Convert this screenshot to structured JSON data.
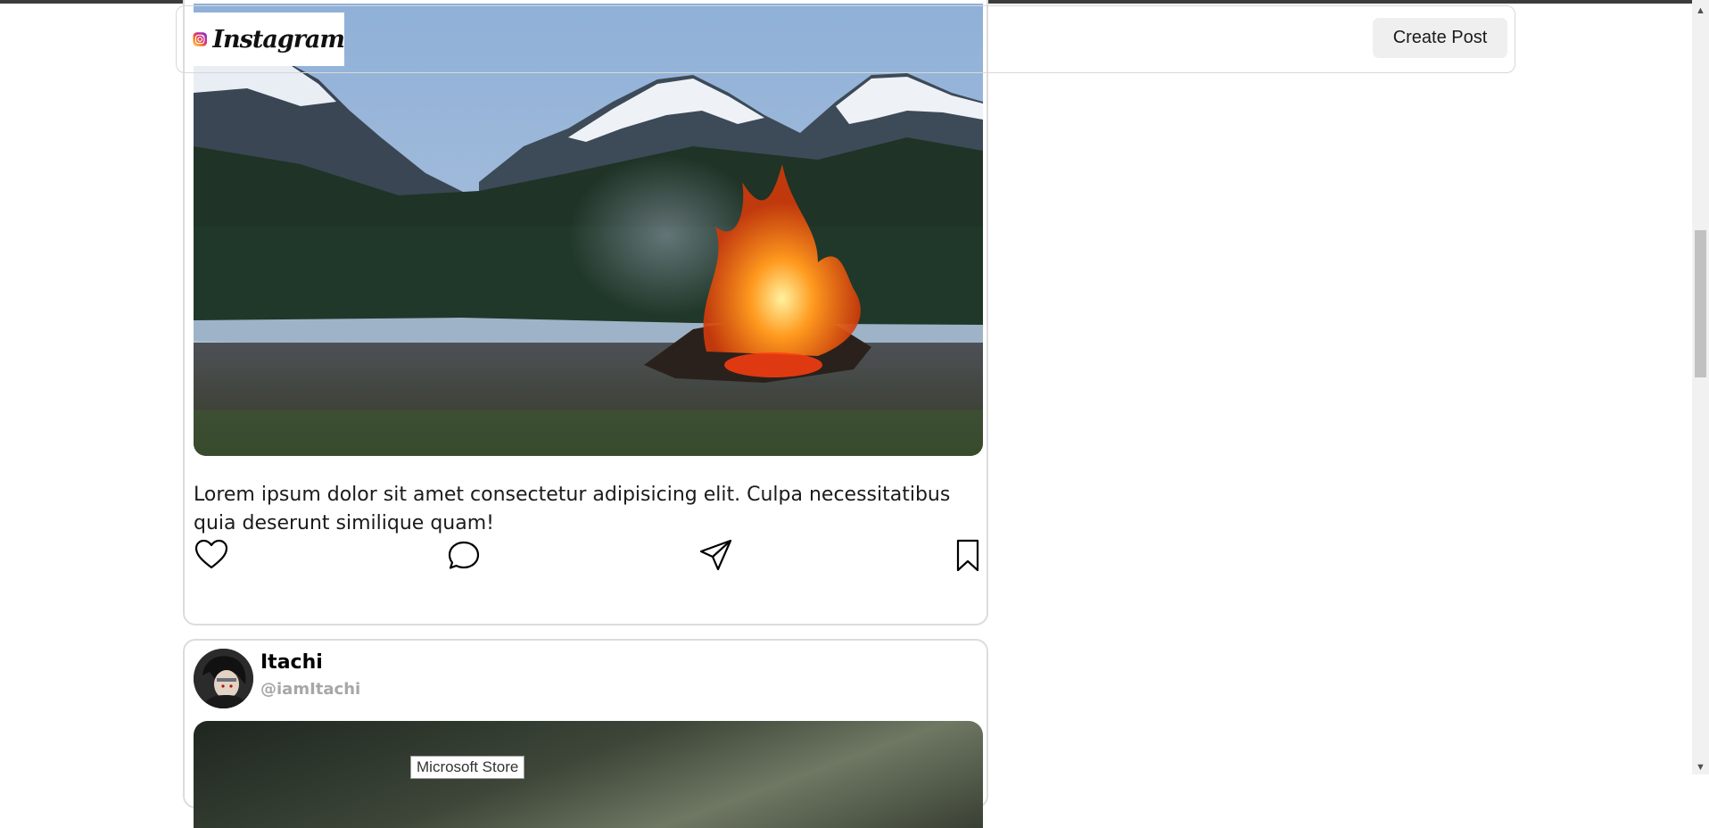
{
  "header": {
    "brand": "Instagram",
    "create_post_label": "Create Post"
  },
  "posts": [
    {
      "image": "campfire-mountains-photo",
      "caption": "Lorem ipsum dolor sit amet consectetur adipisicing elit. Culpa necessitatibus quia deserunt similique quam!",
      "actions": [
        "heart-icon",
        "comment-icon",
        "share-icon",
        "bookmark-icon"
      ]
    },
    {
      "author_name": "Itachi",
      "author_handle": "@iamItachi",
      "image": "sky-landscape-photo"
    }
  ],
  "tooltip": "Microsoft Store",
  "colors": {
    "card_border": "#dcdcdc",
    "handle_gray": "#a7a7a7",
    "button_bg": "#efefef"
  }
}
